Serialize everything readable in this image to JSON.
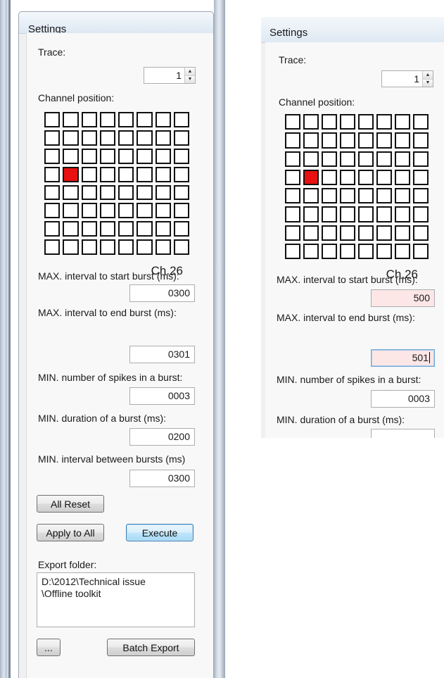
{
  "left": {
    "title": "Settings",
    "trace_label": "Trace:",
    "trace_value": "1",
    "channel_position_label": "Channel position:",
    "selected_channel_label": "Ch.26",
    "selected_cell": {
      "row": 4,
      "col": 2
    },
    "fields": [
      {
        "label": "MAX. interval to start burst (ms):",
        "value": "0300"
      },
      {
        "label": "MAX. interval to end burst (ms):",
        "value": "0301"
      },
      {
        "label": "MIN. number of spikes in a burst:",
        "value": "0003"
      },
      {
        "label": "MIN. duration of a burst (ms):",
        "value": "0200"
      },
      {
        "label": "MIN. interval between bursts (ms)",
        "value": "0300"
      }
    ],
    "buttons": {
      "all_reset": "All Reset",
      "apply_to_all": "Apply to All",
      "execute": "Execute",
      "browse": "...",
      "batch_export": "Batch Export"
    },
    "export_folder_label": "Export folder:",
    "export_folder_value": "D:\\2012\\Technical issue\n\\Offline toolkit"
  },
  "right": {
    "title": "Settings",
    "trace_label": "Trace:",
    "trace_value": "1",
    "channel_position_label": "Channel position:",
    "selected_channel_label": "Ch.26",
    "fields": [
      {
        "label": "MAX. interval to start burst (ms):",
        "value": "500"
      },
      {
        "label": "MAX. interval to end burst (ms):",
        "value": "501"
      },
      {
        "label": "MIN. number of spikes in a burst:",
        "value": "0003"
      },
      {
        "label": "MIN. duration of a burst (ms):",
        "value": ""
      }
    ]
  },
  "colors": {
    "selected_cell": "#e81010",
    "edited_field_bg": "#fde6e6",
    "panel_bg": "#f0f0f0"
  }
}
